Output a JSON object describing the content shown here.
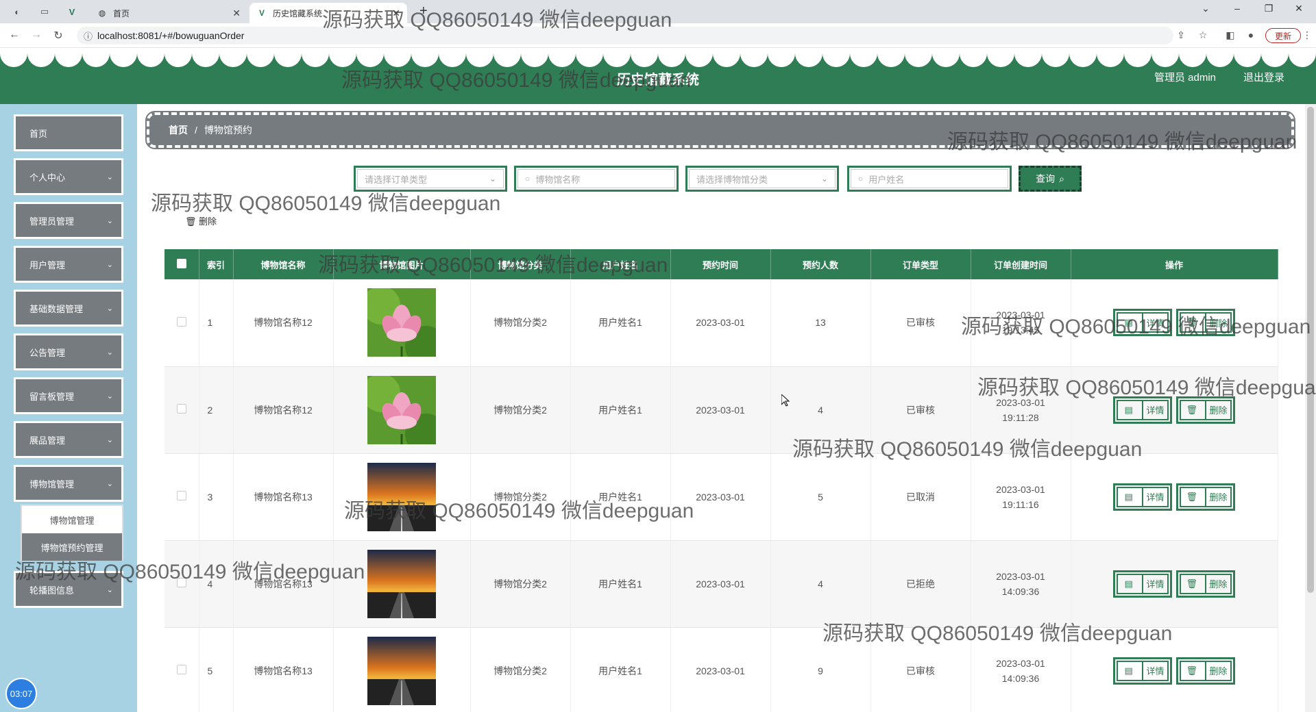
{
  "browser": {
    "tabs": [
      {
        "label": "首页",
        "active": false
      },
      {
        "label": "历史馆藏系统",
        "active": true
      }
    ],
    "url": "localhost:8081/+#/bowuguanOrder",
    "update_label": "更新"
  },
  "header": {
    "title": "历史馆藏系统",
    "admin_label": "管理员 admin",
    "logout_label": "退出登录",
    "color": "#2f7d55"
  },
  "sidebar": {
    "items": [
      {
        "label": "首页",
        "has_children": false
      },
      {
        "label": "个人中心",
        "has_children": true
      },
      {
        "label": "管理员管理",
        "has_children": true
      },
      {
        "label": "用户管理",
        "has_children": true
      },
      {
        "label": "基础数据管理",
        "has_children": true
      },
      {
        "label": "公告管理",
        "has_children": true
      },
      {
        "label": "留言板管理",
        "has_children": true
      },
      {
        "label": "展品管理",
        "has_children": true
      },
      {
        "label": "博物馆管理",
        "has_children": true
      },
      {
        "label": "轮播图信息",
        "has_children": true
      }
    ],
    "submenu": [
      {
        "label": "博物馆管理",
        "active": false
      },
      {
        "label": "博物馆预约管理",
        "active": true
      }
    ],
    "clock": "03:07"
  },
  "breadcrumb": {
    "home": "首页",
    "sep": "/",
    "current": "博物馆预约"
  },
  "search": {
    "order_type_placeholder": "请选择订单类型",
    "museum_name_placeholder": "博物馆名称",
    "museum_category_placeholder": "请选择博物馆分类",
    "user_name_placeholder": "用户姓名",
    "query_label": "查询"
  },
  "actions": {
    "delete_label": "删除"
  },
  "table": {
    "columns": [
      "索引",
      "博物馆名称",
      "博物馆图片",
      "博物馆分类",
      "用户姓名",
      "预约时间",
      "预约人数",
      "订单类型",
      "订单创建时间",
      "操作"
    ],
    "detail_label": "详情",
    "delete_label": "删除",
    "rows": [
      {
        "index": "1",
        "name": "博物馆名称12",
        "image": "lotus",
        "category": "博物馆分类2",
        "user": "用户姓名1",
        "date": "2023-03-01",
        "count": "13",
        "status": "已审核",
        "created": "2023-03-01 19:13:45"
      },
      {
        "index": "2",
        "name": "博物馆名称12",
        "image": "lotus",
        "category": "博物馆分类2",
        "user": "用户姓名1",
        "date": "2023-03-01",
        "count": "4",
        "status": "已审核",
        "created": "2023-03-01 19:11:28"
      },
      {
        "index": "3",
        "name": "博物馆名称13",
        "image": "sunset-road",
        "category": "博物馆分类2",
        "user": "用户姓名1",
        "date": "2023-03-01",
        "count": "5",
        "status": "已取消",
        "created": "2023-03-01 19:11:16"
      },
      {
        "index": "4",
        "name": "博物馆名称13",
        "image": "sunset-road",
        "category": "博物馆分类2",
        "user": "用户姓名1",
        "date": "2023-03-01",
        "count": "4",
        "status": "已拒绝",
        "created": "2023-03-01 14:09:36"
      },
      {
        "index": "5",
        "name": "博物馆名称13",
        "image": "sunset-road",
        "category": "博物馆分类2",
        "user": "用户姓名1",
        "date": "2023-03-01",
        "count": "9",
        "status": "已审核",
        "created": "2023-03-01 14:09:36"
      }
    ]
  },
  "watermark": "源码获取 QQ86050149 微信deepguan"
}
